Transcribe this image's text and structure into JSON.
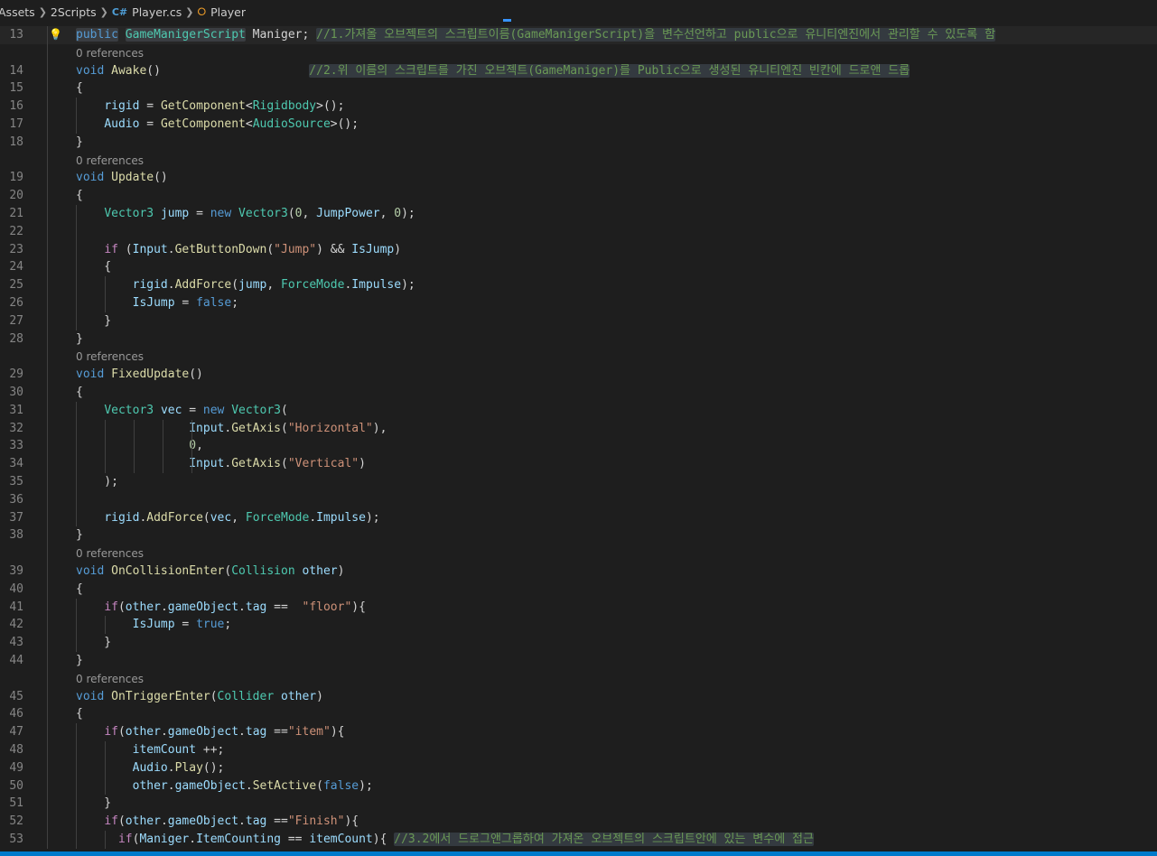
{
  "breadcrumb": {
    "items": [
      "Assets",
      "2Scripts",
      "Player.cs",
      "Player"
    ],
    "file_icon": "C#",
    "class_icon": "class-icon"
  },
  "codelens_text": "0 references",
  "lines": [
    {
      "n": "13",
      "lens": false,
      "hl": true,
      "bulb": true,
      "tokens": [
        [
          "kw",
          "public"
        ],
        [
          "pl",
          " "
        ],
        [
          "ty",
          "GameManigerScript"
        ],
        [
          "pl",
          " Maniger; "
        ],
        [
          "cm",
          "//1.가져올 오브젝트의 스크립트이름(GameManigerScript)을 변수선언하고 public으로 유니티엔진에서 관리할 수 있도록 함"
        ]
      ]
    },
    {
      "n": "14",
      "lens": true,
      "tokens": [
        [
          "kw",
          "void"
        ],
        [
          "pl",
          " "
        ],
        [
          "fn",
          "Awake"
        ],
        [
          "pl",
          "()                     "
        ],
        [
          "cm",
          "//2.위 이름의 스크립트를 가진 오브젝트(GameManiger)를 Public으로 생성된 유니티엔진 빈칸에 드로앤 드롭"
        ]
      ]
    },
    {
      "n": "15",
      "lens": false,
      "tokens": [
        [
          "pl",
          "{"
        ]
      ]
    },
    {
      "n": "16",
      "lens": false,
      "tokens": [
        [
          "pl",
          "    "
        ],
        [
          "vr",
          "rigid"
        ],
        [
          "pl",
          " = "
        ],
        [
          "fn",
          "GetComponent"
        ],
        [
          "pl",
          "<"
        ],
        [
          "ty",
          "Rigidbody"
        ],
        [
          "pl",
          ">();"
        ]
      ]
    },
    {
      "n": "17",
      "lens": false,
      "tokens": [
        [
          "pl",
          "    "
        ],
        [
          "vr",
          "Audio"
        ],
        [
          "pl",
          " = "
        ],
        [
          "fn",
          "GetComponent"
        ],
        [
          "pl",
          "<"
        ],
        [
          "ty",
          "AudioSource"
        ],
        [
          "pl",
          ">();"
        ]
      ]
    },
    {
      "n": "18",
      "lens": false,
      "tokens": [
        [
          "pl",
          "}"
        ]
      ]
    },
    {
      "n": "19",
      "lens": true,
      "tokens": [
        [
          "kw",
          "void"
        ],
        [
          "pl",
          " "
        ],
        [
          "fn",
          "Update"
        ],
        [
          "pl",
          "()"
        ]
      ]
    },
    {
      "n": "20",
      "lens": false,
      "tokens": [
        [
          "pl",
          "{"
        ]
      ]
    },
    {
      "n": "21",
      "lens": false,
      "tokens": [
        [
          "pl",
          "    "
        ],
        [
          "ty",
          "Vector3"
        ],
        [
          "pl",
          " "
        ],
        [
          "vr",
          "jump"
        ],
        [
          "pl",
          " = "
        ],
        [
          "kw",
          "new"
        ],
        [
          "pl",
          " "
        ],
        [
          "ty",
          "Vector3"
        ],
        [
          "pl",
          "("
        ],
        [
          "num",
          "0"
        ],
        [
          "pl",
          ", "
        ],
        [
          "vr",
          "JumpPower"
        ],
        [
          "pl",
          ", "
        ],
        [
          "num",
          "0"
        ],
        [
          "pl",
          ");"
        ]
      ]
    },
    {
      "n": "22",
      "lens": false,
      "tokens": []
    },
    {
      "n": "23",
      "lens": false,
      "tokens": [
        [
          "pl",
          "    "
        ],
        [
          "ctl",
          "if"
        ],
        [
          "pl",
          " ("
        ],
        [
          "vr",
          "Input"
        ],
        [
          "pl",
          "."
        ],
        [
          "fn",
          "GetButtonDown"
        ],
        [
          "pl",
          "("
        ],
        [
          "str",
          "\"Jump\""
        ],
        [
          "pl",
          ") && "
        ],
        [
          "vr",
          "IsJump"
        ],
        [
          "pl",
          ")"
        ]
      ]
    },
    {
      "n": "24",
      "lens": false,
      "tokens": [
        [
          "pl",
          "    {"
        ]
      ]
    },
    {
      "n": "25",
      "lens": false,
      "tokens": [
        [
          "pl",
          "        "
        ],
        [
          "vr",
          "rigid"
        ],
        [
          "pl",
          "."
        ],
        [
          "fn",
          "AddForce"
        ],
        [
          "pl",
          "("
        ],
        [
          "vr",
          "jump"
        ],
        [
          "pl",
          ", "
        ],
        [
          "ty",
          "ForceMode"
        ],
        [
          "pl",
          "."
        ],
        [
          "vr",
          "Impulse"
        ],
        [
          "pl",
          ");"
        ]
      ]
    },
    {
      "n": "26",
      "lens": false,
      "tokens": [
        [
          "pl",
          "        "
        ],
        [
          "vr",
          "IsJump"
        ],
        [
          "pl",
          " = "
        ],
        [
          "kw",
          "false"
        ],
        [
          "pl",
          ";"
        ]
      ]
    },
    {
      "n": "27",
      "lens": false,
      "tokens": [
        [
          "pl",
          "    }"
        ]
      ]
    },
    {
      "n": "28",
      "lens": false,
      "tokens": [
        [
          "pl",
          "}"
        ]
      ]
    },
    {
      "n": "29",
      "lens": true,
      "tokens": [
        [
          "kw",
          "void"
        ],
        [
          "pl",
          " "
        ],
        [
          "fn",
          "FixedUpdate"
        ],
        [
          "pl",
          "()"
        ]
      ]
    },
    {
      "n": "30",
      "lens": false,
      "tokens": [
        [
          "pl",
          "{"
        ]
      ]
    },
    {
      "n": "31",
      "lens": false,
      "tokens": [
        [
          "pl",
          "    "
        ],
        [
          "ty",
          "Vector3"
        ],
        [
          "pl",
          " "
        ],
        [
          "vr",
          "vec"
        ],
        [
          "pl",
          " = "
        ],
        [
          "kw",
          "new"
        ],
        [
          "pl",
          " "
        ],
        [
          "ty",
          "Vector3"
        ],
        [
          "pl",
          "("
        ]
      ]
    },
    {
      "n": "32",
      "lens": false,
      "tokens": [
        [
          "pl",
          "                "
        ],
        [
          "vr",
          "Input"
        ],
        [
          "pl",
          "."
        ],
        [
          "fn",
          "GetAxis"
        ],
        [
          "pl",
          "("
        ],
        [
          "str",
          "\"Horizontal\""
        ],
        [
          "pl",
          "),"
        ]
      ]
    },
    {
      "n": "33",
      "lens": false,
      "tokens": [
        [
          "pl",
          "                "
        ],
        [
          "num",
          "0"
        ],
        [
          "pl",
          ","
        ]
      ]
    },
    {
      "n": "34",
      "lens": false,
      "tokens": [
        [
          "pl",
          "                "
        ],
        [
          "vr",
          "Input"
        ],
        [
          "pl",
          "."
        ],
        [
          "fn",
          "GetAxis"
        ],
        [
          "pl",
          "("
        ],
        [
          "str",
          "\"Vertical\""
        ],
        [
          "pl",
          ")"
        ]
      ]
    },
    {
      "n": "35",
      "lens": false,
      "tokens": [
        [
          "pl",
          "    );"
        ]
      ]
    },
    {
      "n": "36",
      "lens": false,
      "tokens": []
    },
    {
      "n": "37",
      "lens": false,
      "tokens": [
        [
          "pl",
          "    "
        ],
        [
          "vr",
          "rigid"
        ],
        [
          "pl",
          "."
        ],
        [
          "fn",
          "AddForce"
        ],
        [
          "pl",
          "("
        ],
        [
          "vr",
          "vec"
        ],
        [
          "pl",
          ", "
        ],
        [
          "ty",
          "ForceMode"
        ],
        [
          "pl",
          "."
        ],
        [
          "vr",
          "Impulse"
        ],
        [
          "pl",
          ");"
        ]
      ]
    },
    {
      "n": "38",
      "lens": false,
      "tokens": [
        [
          "pl",
          "}"
        ]
      ]
    },
    {
      "n": "39",
      "lens": true,
      "tokens": [
        [
          "kw",
          "void"
        ],
        [
          "pl",
          " "
        ],
        [
          "fn",
          "OnCollisionEnter"
        ],
        [
          "pl",
          "("
        ],
        [
          "ty",
          "Collision"
        ],
        [
          "pl",
          " "
        ],
        [
          "vr",
          "other"
        ],
        [
          "pl",
          ")"
        ]
      ]
    },
    {
      "n": "40",
      "lens": false,
      "tokens": [
        [
          "pl",
          "{"
        ]
      ]
    },
    {
      "n": "41",
      "lens": false,
      "tokens": [
        [
          "pl",
          "    "
        ],
        [
          "ctl",
          "if"
        ],
        [
          "pl",
          "("
        ],
        [
          "vr",
          "other"
        ],
        [
          "pl",
          "."
        ],
        [
          "vr",
          "gameObject"
        ],
        [
          "pl",
          "."
        ],
        [
          "vr",
          "tag"
        ],
        [
          "pl",
          " ==  "
        ],
        [
          "str",
          "\"floor\""
        ],
        [
          "pl",
          "){"
        ]
      ]
    },
    {
      "n": "42",
      "lens": false,
      "tokens": [
        [
          "pl",
          "        "
        ],
        [
          "vr",
          "IsJump"
        ],
        [
          "pl",
          " = "
        ],
        [
          "kw",
          "true"
        ],
        [
          "pl",
          ";"
        ]
      ]
    },
    {
      "n": "43",
      "lens": false,
      "tokens": [
        [
          "pl",
          "    }"
        ]
      ]
    },
    {
      "n": "44",
      "lens": false,
      "tokens": [
        [
          "pl",
          "}"
        ]
      ]
    },
    {
      "n": "45",
      "lens": true,
      "tokens": [
        [
          "kw",
          "void"
        ],
        [
          "pl",
          " "
        ],
        [
          "fn",
          "OnTriggerEnter"
        ],
        [
          "pl",
          "("
        ],
        [
          "ty",
          "Collider"
        ],
        [
          "pl",
          " "
        ],
        [
          "vr",
          "other"
        ],
        [
          "pl",
          ")"
        ]
      ]
    },
    {
      "n": "46",
      "lens": false,
      "tokens": [
        [
          "pl",
          "{"
        ]
      ]
    },
    {
      "n": "47",
      "lens": false,
      "tokens": [
        [
          "pl",
          "    "
        ],
        [
          "ctl",
          "if"
        ],
        [
          "pl",
          "("
        ],
        [
          "vr",
          "other"
        ],
        [
          "pl",
          "."
        ],
        [
          "vr",
          "gameObject"
        ],
        [
          "pl",
          "."
        ],
        [
          "vr",
          "tag"
        ],
        [
          "pl",
          " =="
        ],
        [
          "str",
          "\"item\""
        ],
        [
          "pl",
          "){"
        ]
      ]
    },
    {
      "n": "48",
      "lens": false,
      "tokens": [
        [
          "pl",
          "        "
        ],
        [
          "vr",
          "itemCount"
        ],
        [
          "pl",
          " ++;"
        ]
      ]
    },
    {
      "n": "49",
      "lens": false,
      "tokens": [
        [
          "pl",
          "        "
        ],
        [
          "vr",
          "Audio"
        ],
        [
          "pl",
          "."
        ],
        [
          "fn",
          "Play"
        ],
        [
          "pl",
          "();"
        ]
      ]
    },
    {
      "n": "50",
      "lens": false,
      "tokens": [
        [
          "pl",
          "        "
        ],
        [
          "vr",
          "other"
        ],
        [
          "pl",
          "."
        ],
        [
          "vr",
          "gameObject"
        ],
        [
          "pl",
          "."
        ],
        [
          "fn",
          "SetActive"
        ],
        [
          "pl",
          "("
        ],
        [
          "kw",
          "false"
        ],
        [
          "pl",
          ");"
        ]
      ]
    },
    {
      "n": "51",
      "lens": false,
      "tokens": [
        [
          "pl",
          "    }"
        ]
      ]
    },
    {
      "n": "52",
      "lens": false,
      "tokens": [
        [
          "pl",
          "    "
        ],
        [
          "ctl",
          "if"
        ],
        [
          "pl",
          "("
        ],
        [
          "vr",
          "other"
        ],
        [
          "pl",
          "."
        ],
        [
          "vr",
          "gameObject"
        ],
        [
          "pl",
          "."
        ],
        [
          "vr",
          "tag"
        ],
        [
          "pl",
          " =="
        ],
        [
          "str",
          "\"Finish\""
        ],
        [
          "pl",
          "){"
        ]
      ]
    },
    {
      "n": "53",
      "lens": false,
      "tokens": [
        [
          "pl",
          "      "
        ],
        [
          "ctl",
          "if"
        ],
        [
          "pl",
          "("
        ],
        [
          "vr",
          "Maniger"
        ],
        [
          "pl",
          "."
        ],
        [
          "vr",
          "ItemCounting"
        ],
        [
          "pl",
          " == "
        ],
        [
          "vr",
          "itemCount"
        ],
        [
          "pl",
          "){ "
        ],
        [
          "cm",
          "//3.2에서 드로그앤그롭하여 가져온 오브젝트의 스크립트안에 있는 변수에 접근"
        ]
      ]
    }
  ]
}
